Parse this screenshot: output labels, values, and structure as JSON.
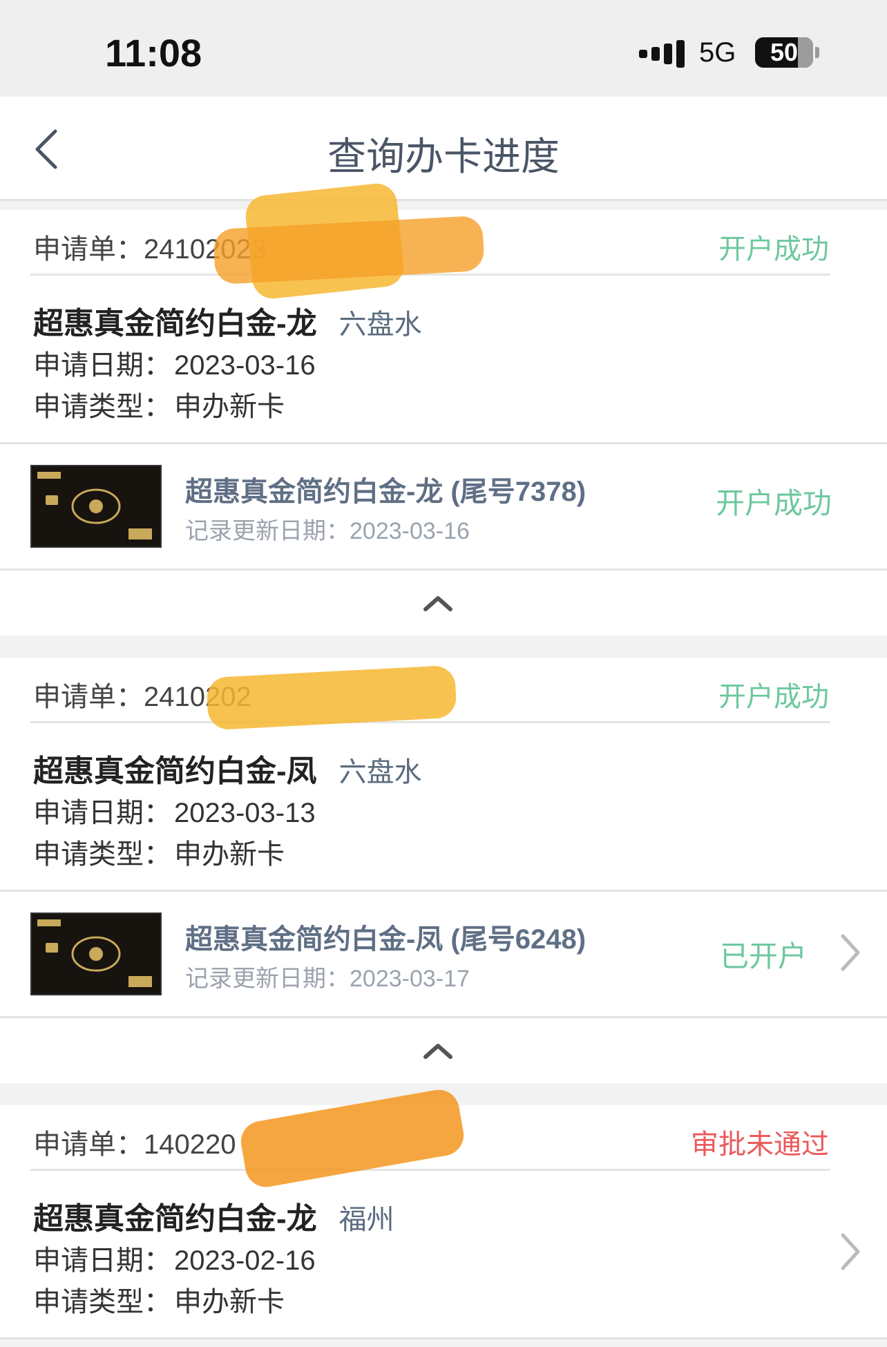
{
  "status_bar": {
    "time": "11:08",
    "network": "5G",
    "battery": "50"
  },
  "nav": {
    "title": "查询办卡进度"
  },
  "labels": {
    "req_prefix": "申请单：",
    "apply_date": "申请日期：",
    "apply_type": "申请类型：",
    "record_update": "记录更新日期："
  },
  "applications": [
    {
      "request_no": "24102023",
      "status": "开户成功",
      "product": "超惠真金简约白金-龙",
      "city": "六盘水",
      "apply_date": "2023-03-16",
      "apply_type": "申办新卡",
      "card_item": {
        "title": "超惠真金简约白金-龙 (尾号7378)",
        "update_date": "2023-03-16",
        "status": "开户成功"
      }
    },
    {
      "request_no": "2410202",
      "status": "开户成功",
      "product": "超惠真金简约白金-凤",
      "city": "六盘水",
      "apply_date": "2023-03-13",
      "apply_type": "申办新卡",
      "card_item": {
        "title": "超惠真金简约白金-凤 (尾号6248)",
        "update_date": "2023-03-17",
        "status": "已开户"
      }
    },
    {
      "request_no": "140220",
      "status": "审批未通过",
      "product": "超惠真金简约白金-龙",
      "city": "福州",
      "apply_date": "2023-02-16",
      "apply_type": "申办新卡"
    }
  ],
  "colors": {
    "success": "#6cc89e",
    "fail": "#ea5a5a",
    "redaction": "#f7b733"
  }
}
